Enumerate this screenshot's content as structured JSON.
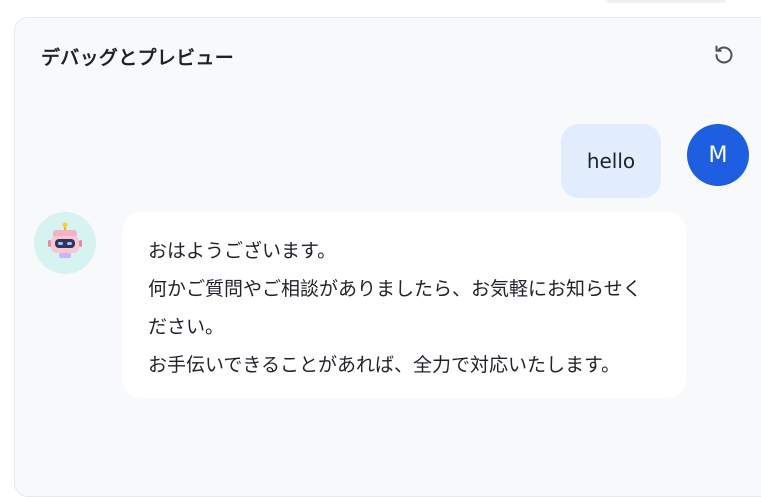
{
  "panel": {
    "title": "デバッグとプレビュー",
    "reset_icon": "refresh-icon"
  },
  "messages": {
    "user": {
      "text": "hello",
      "avatar_initial": "M",
      "avatar_color": "#1d5fe0",
      "bubble_color": "#e1ecfd"
    },
    "bot": {
      "avatar_icon": "robot-icon",
      "avatar_bg": "#d6f3f1",
      "lines": [
        "おはようございます。",
        "何かご質問やご相談がありましたら、お気軽にお知らせく",
        "ださい。",
        "お手伝いできることがあれば、全力で対応いたします。"
      ]
    }
  }
}
